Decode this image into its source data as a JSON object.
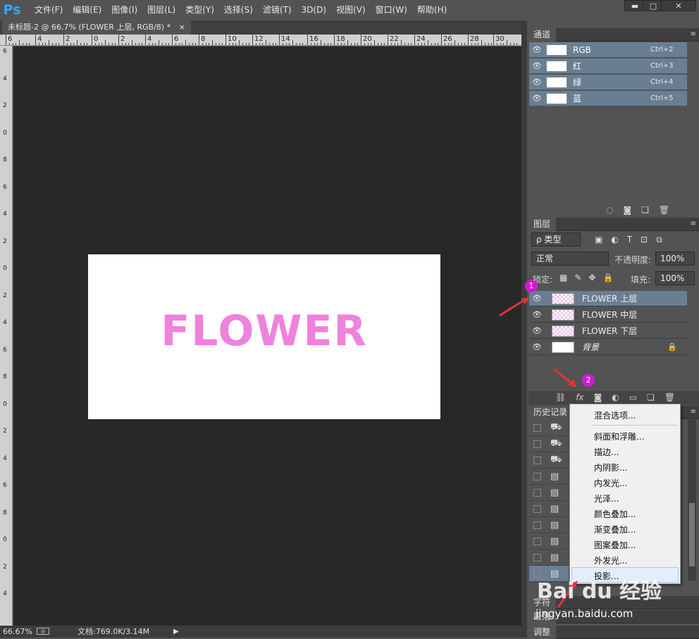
{
  "app": {
    "logo": "Ps"
  },
  "menu": [
    "文件(F)",
    "编辑(E)",
    "图像(I)",
    "图层(L)",
    "类型(Y)",
    "选择(S)",
    "滤镜(T)",
    "3D(D)",
    "视图(V)",
    "窗口(W)",
    "帮助(H)"
  ],
  "window_controls": {
    "minimize": "▬",
    "restore": "□",
    "close": "✕"
  },
  "document_tab": {
    "title": "未标题-2 @ 66.7% (FLOWER 上层, RGB/8) *",
    "close": "×"
  },
  "ruler_h_labels": [
    "6",
    "4",
    "2",
    "0",
    "2",
    "4",
    "6",
    "8",
    "10",
    "12",
    "14",
    "16",
    "18",
    "20",
    "22",
    "24",
    "26",
    "28",
    "30"
  ],
  "ruler_v_labels": [
    "6",
    "4",
    "2",
    "0",
    "8",
    "6",
    "4",
    "2",
    "0",
    "2",
    "4",
    "6",
    "8",
    "0",
    "2",
    "4",
    "6",
    "8",
    "0",
    "2",
    "4"
  ],
  "canvas": {
    "text": "FLOWER",
    "text_color": "#ee82dd"
  },
  "status": {
    "zoom": "66.67%",
    "doc_info": "文档:769.0K/3.14M"
  },
  "channels": {
    "tab": "通道",
    "rows": [
      {
        "name": "RGB",
        "shortcut": "Ctrl+2"
      },
      {
        "name": "红",
        "shortcut": "Ctrl+3"
      },
      {
        "name": "绿",
        "shortcut": "Ctrl+4"
      },
      {
        "name": "蓝",
        "shortcut": "Ctrl+5"
      }
    ]
  },
  "layers": {
    "tab": "图层",
    "filter_kind": "ρ 类型",
    "blend_mode": "正常",
    "opacity_label": "不透明度:",
    "opacity_value": "100%",
    "lock_label": "锁定:",
    "fill_label": "填充:",
    "fill_value": "100%",
    "rows": [
      {
        "name": "FLOWER 上层",
        "selected": true
      },
      {
        "name": "FLOWER 中层",
        "selected": false
      },
      {
        "name": "FLOWER 下层",
        "selected": false
      },
      {
        "name": "背景",
        "selected": false
      }
    ]
  },
  "history": {
    "tab": "历史记录"
  },
  "fx_menu": {
    "items": [
      "混合选项...",
      "斜面和浮雕...",
      "描边...",
      "内阴影...",
      "内发光...",
      "光泽...",
      "颜色叠加...",
      "渐变叠加...",
      "图案叠加...",
      "外发光...",
      "投影..."
    ]
  },
  "bottom_panels": {
    "character": "字符",
    "paragraph": "段落",
    "adjust": "调整"
  },
  "callouts": {
    "one": "1",
    "two": "2"
  },
  "watermark": {
    "brand": "Bai du 经验",
    "url": "jingyan.baidu.com"
  },
  "colors": {
    "accent_selection": "#6a7e92",
    "callout": "#d21bd2",
    "ps_blue": "#31a8ff"
  }
}
